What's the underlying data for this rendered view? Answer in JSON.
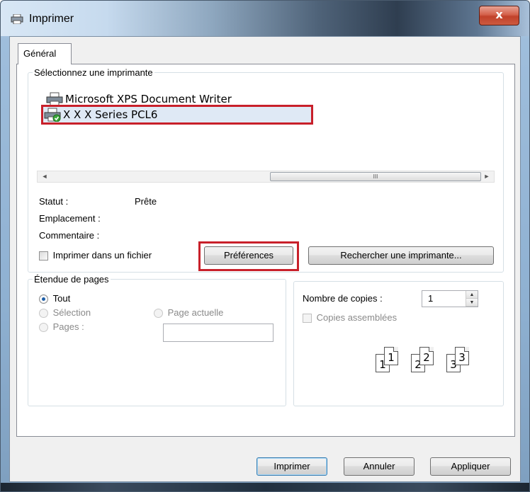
{
  "window": {
    "title": "Imprimer",
    "close_glyph": "x"
  },
  "tabs": [
    {
      "label": "Général",
      "active": true
    }
  ],
  "printer_group": {
    "legend": "Sélectionnez une imprimante",
    "printers": [
      {
        "name": "Microsoft XPS Document Writer",
        "icon": "printer-icon",
        "selected": false
      },
      {
        "name": "X X X Series PCL6",
        "icon": "default-printer-icon",
        "selected": true
      }
    ],
    "scroll_thumb_glyph": "III",
    "scroll_left_glyph": "◄",
    "scroll_right_glyph": "►",
    "status_label": "Statut :",
    "status_value": "Prête",
    "location_label": "Emplacement :",
    "comment_label": "Commentaire :",
    "print_to_file_label": "Imprimer dans un fichier",
    "preferences_button": "Préférences",
    "find_printer_button": "Rechercher une imprimante..."
  },
  "page_range": {
    "legend": "Étendue de pages",
    "options": [
      {
        "label": "Tout",
        "checked": true,
        "enabled": true
      },
      {
        "label": "Sélection",
        "checked": false,
        "enabled": false
      },
      {
        "label": "Pages :",
        "checked": false,
        "enabled": false
      },
      {
        "label": "Page actuelle",
        "checked": false,
        "enabled": false
      }
    ],
    "pages_value": ""
  },
  "copies": {
    "label": "Nombre de copies :",
    "value": "1",
    "collate_label": "Copies assemblées",
    "collate_checked": false,
    "collate_sheets": [
      "1",
      "1",
      "2",
      "2",
      "3",
      "3"
    ]
  },
  "footer": {
    "print_button": "Imprimer",
    "cancel_button": "Annuler",
    "apply_button": "Appliquer"
  },
  "colors": {
    "highlight": "#c8202a",
    "selection": "#dfe9f5",
    "default_button_border": "#3c7fb1"
  }
}
